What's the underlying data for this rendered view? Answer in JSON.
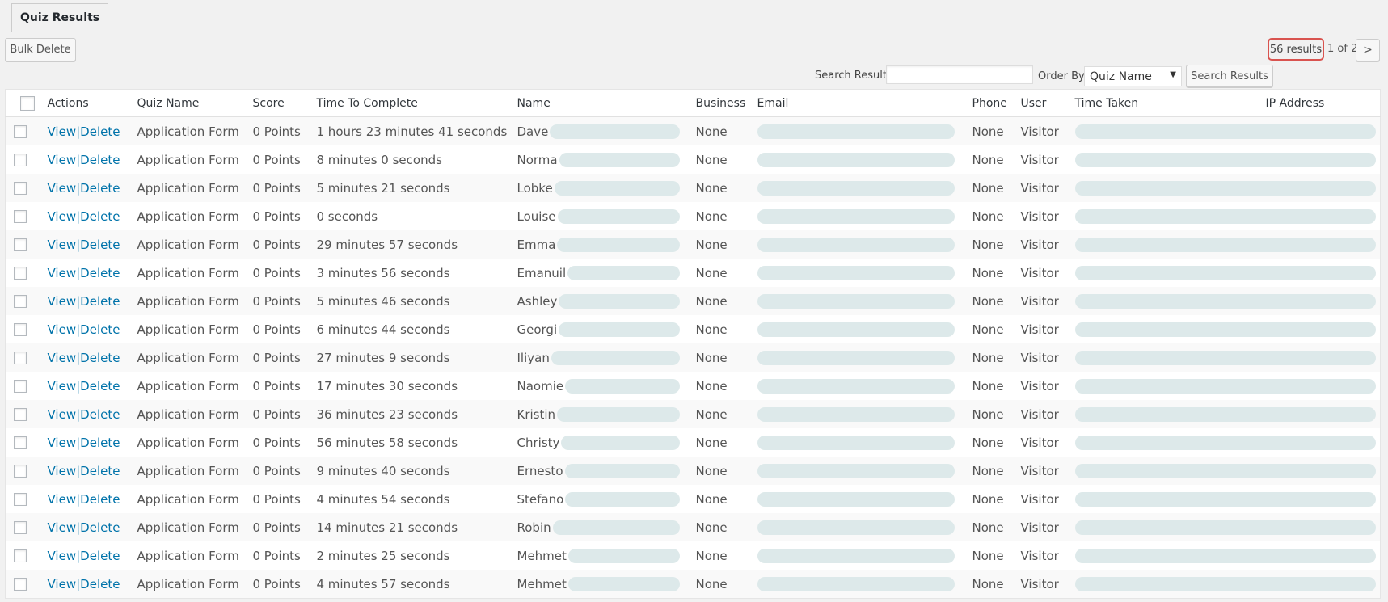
{
  "tab": {
    "label": "Quiz Results"
  },
  "toolbar": {
    "bulk_delete_label": "Bulk Delete",
    "results_count": "56 results",
    "page_info": "1 of 2",
    "next_label": ">",
    "search_label": "Search Results",
    "search_value": "",
    "order_by_label": "Order By",
    "order_by_selected": "Quiz Name",
    "search_button_label": "Search Results"
  },
  "colors": {
    "link": "#0073aa",
    "highlight_border": "#d9534f",
    "redacted": "#dde9ea"
  },
  "table": {
    "headers": {
      "actions": "Actions",
      "quiz_name": "Quiz Name",
      "score": "Score",
      "time_to_complete": "Time To Complete",
      "name": "Name",
      "business": "Business",
      "email": "Email",
      "phone": "Phone",
      "user": "User",
      "time_taken": "Time Taken",
      "ip_address": "IP Address"
    },
    "action_view": "View",
    "action_delete": "Delete",
    "action_separator": "|",
    "rows": [
      {
        "quiz": "Application Form",
        "score": "0 Points",
        "time": "1 hours 23 minutes 41 seconds",
        "name": "Dave",
        "business": "None",
        "phone": "None",
        "user": "Visitor"
      },
      {
        "quiz": "Application Form",
        "score": "0 Points",
        "time": "8 minutes 0 seconds",
        "name": "Norma",
        "business": "None",
        "phone": "None",
        "user": "Visitor"
      },
      {
        "quiz": "Application Form",
        "score": "0 Points",
        "time": "5 minutes 21 seconds",
        "name": "Lobke",
        "business": "None",
        "phone": "None",
        "user": "Visitor"
      },
      {
        "quiz": "Application Form",
        "score": "0 Points",
        "time": "0 seconds",
        "name": "Louise",
        "business": "None",
        "phone": "None",
        "user": "Visitor"
      },
      {
        "quiz": "Application Form",
        "score": "0 Points",
        "time": "29 minutes 57 seconds",
        "name": "Emma",
        "business": "None",
        "phone": "None",
        "user": "Visitor"
      },
      {
        "quiz": "Application Form",
        "score": "0 Points",
        "time": "3 minutes 56 seconds",
        "name": "Emanuil",
        "business": "None",
        "phone": "None",
        "user": "Visitor"
      },
      {
        "quiz": "Application Form",
        "score": "0 Points",
        "time": "5 minutes 46 seconds",
        "name": "Ashley",
        "business": "None",
        "phone": "None",
        "user": "Visitor"
      },
      {
        "quiz": "Application Form",
        "score": "0 Points",
        "time": "6 minutes 44 seconds",
        "name": "Georgi",
        "business": "None",
        "phone": "None",
        "user": "Visitor"
      },
      {
        "quiz": "Application Form",
        "score": "0 Points",
        "time": "27 minutes 9 seconds",
        "name": "Iliyan",
        "business": "None",
        "phone": "None",
        "user": "Visitor"
      },
      {
        "quiz": "Application Form",
        "score": "0 Points",
        "time": "17 minutes 30 seconds",
        "name": "Naomie",
        "business": "None",
        "phone": "None",
        "user": "Visitor"
      },
      {
        "quiz": "Application Form",
        "score": "0 Points",
        "time": "36 minutes 23 seconds",
        "name": "Kristin",
        "business": "None",
        "phone": "None",
        "user": "Visitor"
      },
      {
        "quiz": "Application Form",
        "score": "0 Points",
        "time": "56 minutes 58 seconds",
        "name": "Christy",
        "business": "None",
        "phone": "None",
        "user": "Visitor"
      },
      {
        "quiz": "Application Form",
        "score": "0 Points",
        "time": "9 minutes 40 seconds",
        "name": "Ernesto",
        "business": "None",
        "phone": "None",
        "user": "Visitor"
      },
      {
        "quiz": "Application Form",
        "score": "0 Points",
        "time": "4 minutes 54 seconds",
        "name": "Stefano",
        "business": "None",
        "phone": "None",
        "user": "Visitor"
      },
      {
        "quiz": "Application Form",
        "score": "0 Points",
        "time": "14 minutes 21 seconds",
        "name": "Robin",
        "business": "None",
        "phone": "None",
        "user": "Visitor"
      },
      {
        "quiz": "Application Form",
        "score": "0 Points",
        "time": "2 minutes 25 seconds",
        "name": "Mehmet",
        "business": "None",
        "phone": "None",
        "user": "Visitor"
      },
      {
        "quiz": "Application Form",
        "score": "0 Points",
        "time": "4 minutes 57 seconds",
        "name": "Mehmet",
        "business": "None",
        "phone": "None",
        "user": "Visitor"
      }
    ]
  }
}
